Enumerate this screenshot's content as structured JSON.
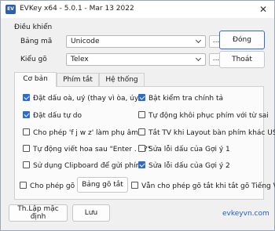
{
  "window": {
    "title": "EVKey x64 - 5.0.1 - Mar 13 2022",
    "icon_text": "EV"
  },
  "controls": {
    "group_label": "Điều khiển",
    "charset_label": "Bảng mã",
    "charset_value": "Unicode",
    "method_label": "Kiểu gõ",
    "method_value": "Telex",
    "more_label": "..."
  },
  "buttons": {
    "close": "Đóng",
    "exit": "Thoát",
    "default": "Th.Lập mặc định",
    "save": "Lưu",
    "shortcut_table": "Bảng gõ tắt"
  },
  "tabs": [
    {
      "label": "Cơ bản",
      "active": true
    },
    {
      "label": "Phím tắt",
      "active": false
    },
    {
      "label": "Hệ thống",
      "active": false
    }
  ],
  "options_left": [
    {
      "label": "Đặt dấu oà, uý (thay vì òa, úy)",
      "checked": true
    },
    {
      "label": "Đặt dấu tự do",
      "checked": true
    },
    {
      "label": "Cho phép 'f j w z' làm phụ âm",
      "checked": false
    },
    {
      "label": "Tự động viết hoa sau \"Enter . ! ?\"",
      "checked": false
    },
    {
      "label": "Sử dụng Clipboard để gửi phím",
      "checked": false
    }
  ],
  "options_right": [
    {
      "label": "Bật kiểm tra chính tả",
      "checked": true
    },
    {
      "label": "Tự động khôi phục phím với từ sai",
      "checked": false
    },
    {
      "label": "Tắt TV khi Layout bàn phím khác US",
      "checked": false
    },
    {
      "label": "Sửa lỗi dấu của Gợi ý 1",
      "checked": false
    },
    {
      "label": "Sửa lỗi dấu của Gợi ý 2",
      "checked": true
    }
  ],
  "shortcut": {
    "allow_label": "Cho phép gõ tắt",
    "allow_checked": false,
    "allow_off_label": "Vẫn cho phép gõ tắt khi tắt gõ Tiếng Việt",
    "allow_off_checked": false
  },
  "footer": {
    "link": "evkeyvn.com"
  },
  "colors": {
    "accent": "#2e6bd1",
    "link": "#1f5fbf"
  }
}
